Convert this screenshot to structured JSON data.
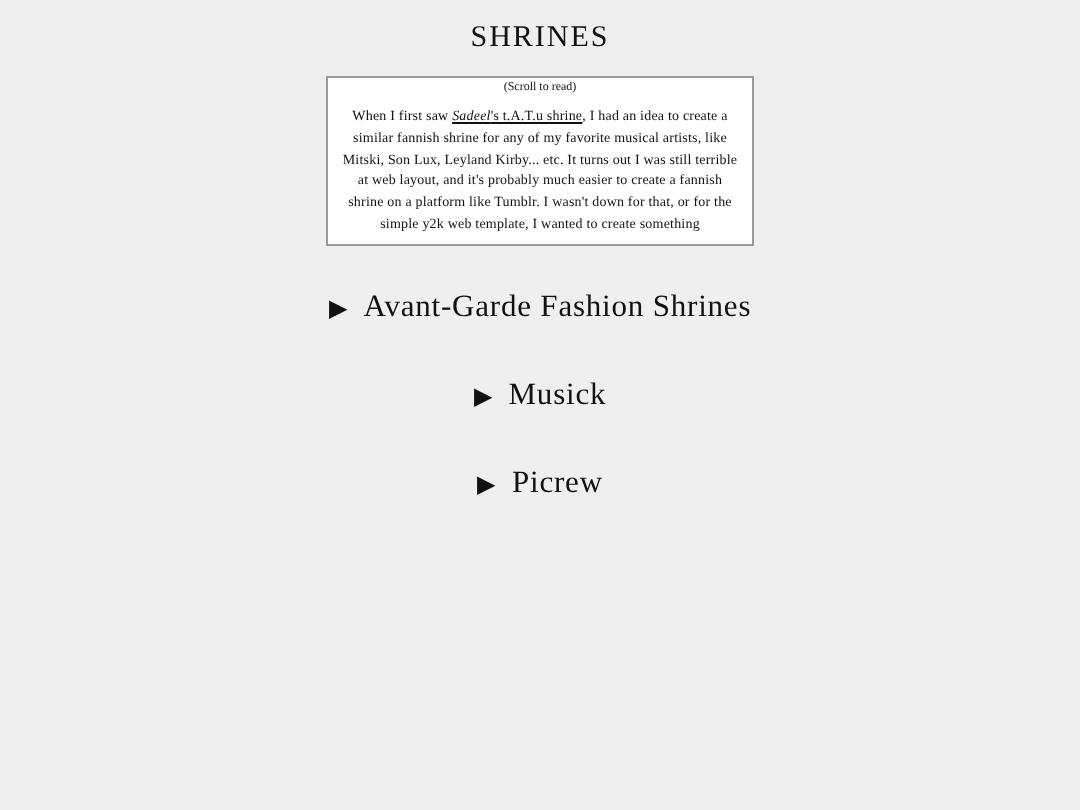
{
  "title": "SHRINES",
  "intro": {
    "hint": "(Scroll to read)",
    "text_before": "When I first saw ",
    "link": "*Sadeel*'s t.A.T.u shrine",
    "text_after": ", I had an idea to create a similar fannish shrine for any of my favorite musical artists, like Mitski, Son Lux, Leyland Kirby... etc. It turns out I was still terrible at web layout, and it's probably much easier to create a fannish shrine on a platform like Tumblr. I wasn't down for that, or for the simple y2k web template, I wanted to create something"
  },
  "sections": [
    {
      "marker": "▶",
      "label": "Avant-Garde Fashion Shrines",
      "expanded": false
    },
    {
      "marker": "▶",
      "label": "Musick",
      "expanded": false
    },
    {
      "marker": "▶",
      "label": "Picrew",
      "expanded": false
    }
  ]
}
